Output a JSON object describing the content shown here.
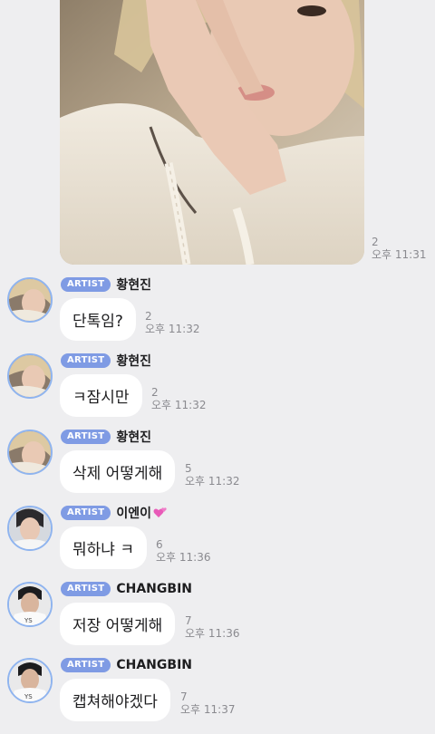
{
  "photo_message": {
    "read_count": "2",
    "time": "오후 11:31"
  },
  "artist_badge": "ARTIST",
  "messages": [
    {
      "sender": "황현진",
      "text": "단톡임?",
      "read_count": "2",
      "time": "오후 11:32"
    },
    {
      "sender": "황현진",
      "text": "ㅋ잠시만",
      "read_count": "2",
      "time": "오후 11:32"
    },
    {
      "sender": "황현진",
      "text": "삭제 어떻게해",
      "read_count": "5",
      "time": "오후 11:32"
    },
    {
      "sender": "이엔이",
      "text": "뭐하냐 ㅋ",
      "read_count": "6",
      "time": "오후 11:36"
    },
    {
      "sender": "CHANGBIN",
      "text": "저장 어떻게해",
      "read_count": "7",
      "time": "오후 11:36"
    },
    {
      "sender": "CHANGBIN",
      "text": "캡쳐해야겠다",
      "read_count": "7",
      "time": "오후 11:37"
    }
  ],
  "colors": {
    "background": "#eeeef0",
    "bubble": "#ffffff",
    "badge": "#7f9be4",
    "avatar_ring": "#8fb4ef",
    "meta_text": "#8a8a8f"
  }
}
